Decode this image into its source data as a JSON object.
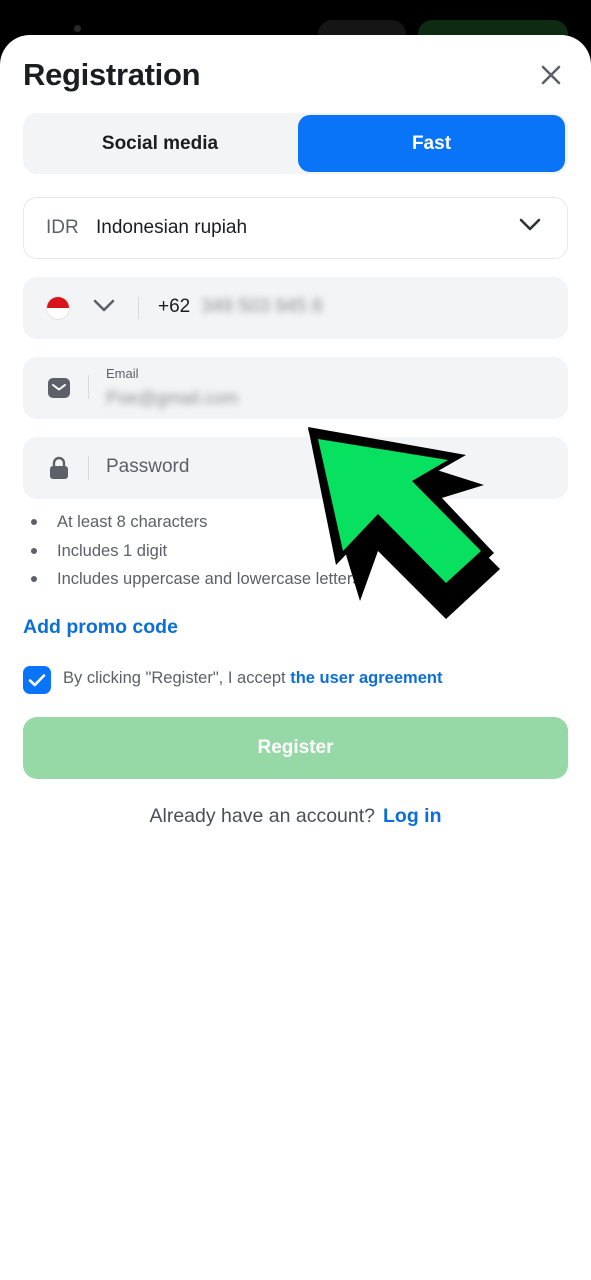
{
  "sheet": {
    "title": "Registration"
  },
  "tabs": [
    {
      "label": "Social media",
      "active": false
    },
    {
      "label": "Fast",
      "active": true
    }
  ],
  "currency": {
    "code": "IDR",
    "name": "Indonesian rupiah"
  },
  "phone": {
    "country_prefix": "+62",
    "number": "349 503 945 8"
  },
  "email": {
    "label": "Email",
    "value": "Poe@gmail.com"
  },
  "password": {
    "placeholder": "Password"
  },
  "password_rules": [
    "At least 8 characters",
    "Includes 1 digit",
    "Includes uppercase and lowercase letters"
  ],
  "promo": {
    "label": "Add promo code"
  },
  "agreement": {
    "checked": true,
    "prefix": "By clicking \"Register\", I accept ",
    "link": "the user agreement"
  },
  "register_button": {
    "label": "Register"
  },
  "login": {
    "prompt": "Already have an account?",
    "link": "Log in"
  },
  "icons": {
    "close": "close-icon",
    "dropdown": "chevron-down-icon",
    "flag": "indonesia-flag-icon",
    "email": "envelope-icon",
    "password": "lock-icon",
    "checkbox": "check-icon",
    "pointer": "green-arrow-icon"
  },
  "colors": {
    "primary_blue": "#0a74f9",
    "link_blue": "#0c6fd9",
    "register_disabled_green": "#97d9a6",
    "arrow_green": "#08e060",
    "field_background": "#f3f4f6"
  }
}
